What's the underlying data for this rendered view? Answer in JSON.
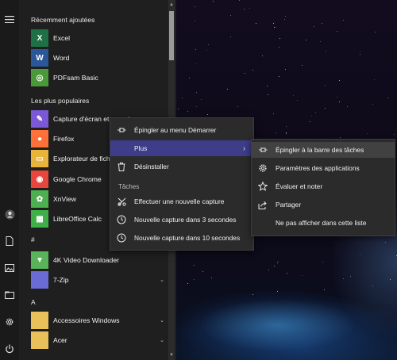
{
  "start_menu": {
    "hamburger_icon": "hamburger-icon",
    "recent_header": "Récemment ajoutées",
    "recent_apps": [
      {
        "label": "Excel",
        "color": "#1e7145",
        "glyph": "X"
      },
      {
        "label": "Word",
        "color": "#2b579a",
        "glyph": "W"
      },
      {
        "label": "PDFsam Basic",
        "color": "#4a9a3a",
        "glyph": "◎"
      }
    ],
    "popular_header": "Les plus populaires",
    "popular_apps": [
      {
        "label": "Capture d'écran et croquis",
        "color": "#7a58d6",
        "glyph": "✎"
      },
      {
        "label": "Firefox",
        "color": "#ff7139",
        "glyph": "●"
      },
      {
        "label": "Explorateur de fichiers",
        "color": "#e8b53a",
        "glyph": "▭"
      },
      {
        "label": "Google Chrome",
        "color": "#e8453c",
        "glyph": "◉"
      },
      {
        "label": "XnView",
        "color": "#4caf50",
        "glyph": "✿"
      },
      {
        "label": "LibreOffice Calc",
        "color": "#3faf47",
        "glyph": "▦"
      }
    ],
    "hash_header": "#",
    "hash_apps": [
      {
        "label": "4K Video Downloader",
        "color": "#59b35a",
        "glyph": "▼",
        "has_chevron": false
      },
      {
        "label": "7-Zip",
        "color": "#6b6bd6",
        "glyph": "",
        "has_chevron": true
      }
    ],
    "a_header": "A",
    "a_apps": [
      {
        "label": "Accessoires Windows",
        "color": "#e8c15a",
        "glyph": "",
        "has_chevron": true
      },
      {
        "label": "Acer",
        "color": "#e8c15a",
        "glyph": "",
        "has_chevron": true
      }
    ]
  },
  "rail_icons": [
    "user-icon",
    "document-icon",
    "pictures-icon",
    "file-explorer-icon",
    "settings-icon",
    "power-icon"
  ],
  "context_menu": {
    "items": [
      {
        "label": "Épingler au menu Démarrer",
        "icon": "pin-icon"
      },
      {
        "label": "Plus",
        "icon": "",
        "submenu": true
      },
      {
        "label": "Désinstaller",
        "icon": "trash-icon"
      }
    ],
    "tasks_header": "Tâches",
    "tasks": [
      {
        "label": "Effectuer une nouvelle capture",
        "icon": "snip-icon"
      },
      {
        "label": "Nouvelle capture dans 3 secondes",
        "icon": "timer-3-icon"
      },
      {
        "label": "Nouvelle capture dans 10 secondes",
        "icon": "timer-10-icon"
      }
    ]
  },
  "submenu": {
    "items": [
      {
        "label": "Épingler à la barre des tâches",
        "icon": "pin-taskbar-icon"
      },
      {
        "label": "Paramètres des applications",
        "icon": "gear-icon"
      },
      {
        "label": "Évaluer et noter",
        "icon": "star-icon"
      },
      {
        "label": "Partager",
        "icon": "share-icon"
      },
      {
        "label": "Ne pas afficher dans cette liste",
        "icon": ""
      }
    ]
  },
  "colors": {
    "highlight": "#3d3d8a",
    "menu_bg": "#2b2b2b",
    "start_bg": "#1f1f1f"
  }
}
